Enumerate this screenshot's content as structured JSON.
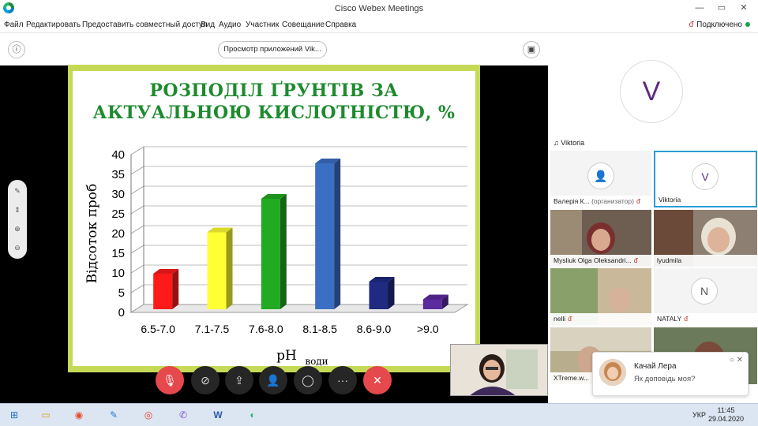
{
  "window": {
    "title": "Cisco Webex Meetings",
    "minimize": "—",
    "maximize": "▭",
    "close": "✕"
  },
  "menu": {
    "items": [
      "Файл",
      "Редактировать",
      "Предоставить совместный доступ",
      "Вид",
      "Аудио",
      "Участник",
      "Совещание",
      "Справка"
    ],
    "connection": "Подключено"
  },
  "share": {
    "view_pill": "Просмотр приложений Vik...",
    "slide_title_line1": "РОЗПОДІЛ ҐРУНТІВ ЗА",
    "slide_title_line2": "АКТУАЛЬНОЮ КИСЛОТНІСТЮ, %"
  },
  "chart_data": {
    "type": "bar",
    "categories": [
      "6.5-7.0",
      "7.1-7.5",
      "7.6-8.0",
      "8.1-8.5",
      "8.6-9.0",
      ">9.0"
    ],
    "values": [
      9,
      19.5,
      28,
      37,
      7,
      2.5
    ],
    "colors": [
      "#ff1a1a",
      "#ffff33",
      "#22aa22",
      "#3b6fc4",
      "#1f2a80",
      "#5b2a9e"
    ],
    "ylabel": "Відсоток проб",
    "xlabel": "pH",
    "xlabel_sub": "води",
    "ylim": [
      0,
      40
    ],
    "yticks": [
      0,
      5,
      10,
      15,
      20,
      25,
      30,
      35,
      40
    ],
    "grid": true
  },
  "controls": {
    "mute": "mic-muted-icon",
    "video": "camera-off-icon",
    "share": "share-icon",
    "participants": "participants-icon",
    "chat": "chat-icon",
    "more": "···",
    "leave": "✕"
  },
  "panel": {
    "active_initial": "V",
    "active_name": "Viktoria",
    "tiles": [
      {
        "name": "Валерія К...",
        "role": "(организатор)",
        "initial": "",
        "muted": true
      },
      {
        "name": "Viktoria",
        "initial": "V",
        "muted": false
      },
      {
        "name": "Mysliuk Olga Oleksandri...",
        "muted": true
      },
      {
        "name": "lyudmila",
        "muted": false
      },
      {
        "name": "nelli",
        "muted": true
      },
      {
        "name": "NATALY",
        "initial": "N",
        "muted": true
      },
      {
        "name": "XTreme.w...",
        "muted": false
      }
    ]
  },
  "chat": {
    "name": "Качай Лера",
    "message": "Як доповідь моя?"
  },
  "taskbar": {
    "lang": "УКР",
    "time": "11:45",
    "date": "29.04.2020"
  }
}
